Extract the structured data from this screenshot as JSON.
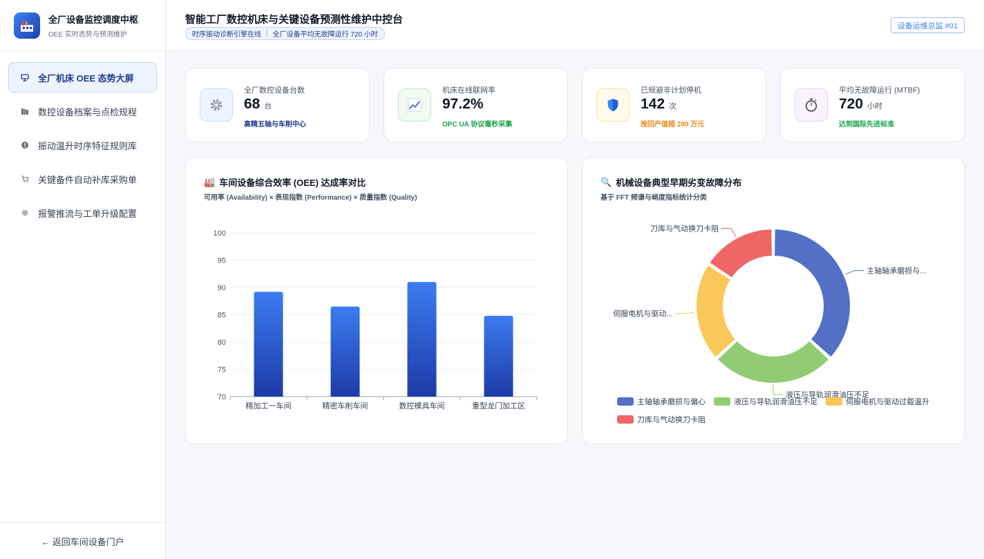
{
  "app": {
    "title": "全厂设备监控调度中枢",
    "subtitle": "OEE 实时态势与预测维护"
  },
  "sidebar": {
    "items": [
      {
        "label": "全厂机床 OEE 态势大屏",
        "icon": "monitor-icon",
        "active": true
      },
      {
        "label": "数控设备档案与点检规程",
        "icon": "archive-icon",
        "active": false
      },
      {
        "label": "振动温升时序特征规则库",
        "icon": "alert-icon",
        "active": false
      },
      {
        "label": "关键备件自动补库采购单",
        "icon": "cart-icon",
        "active": false
      },
      {
        "label": "报警推流与工单升级配置",
        "icon": "gear-icon",
        "active": false
      }
    ],
    "footer": "← 返回车间设备门户"
  },
  "header": {
    "title": "智能工厂数控机床与关键设备预测性维护中控台",
    "pill_left": "时序振动诊断引擎在线",
    "pill_sep": "|",
    "pill_right": "全厂设备平均无故障运行 720 小时",
    "badge": "设备运维总监 #01"
  },
  "kpis": [
    {
      "label": "全厂数控设备台数",
      "value": "68",
      "unit": "台",
      "note": "高精五轴与车削中心",
      "note_color": "#1e3a8a",
      "icon": "gear-icon",
      "icon_glyph": "⚙️",
      "icon_bg": "#eef4ff",
      "icon_border": "#c9dafb"
    },
    {
      "label": "机床在线联网率",
      "value": "97.2%",
      "unit": "",
      "note": "OPC UA 协议毫秒采集",
      "note_color": "#16a34a",
      "icon": "chart-up-icon",
      "icon_glyph": "📈",
      "icon_bg": "#effbf3",
      "icon_border": "#bfe9cd"
    },
    {
      "label": "已规避非计划停机",
      "value": "142",
      "unit": "次",
      "note": "挽回产值超 280 万元",
      "note_color": "#ea8a1a",
      "icon": "shield-icon",
      "icon_glyph": "🛡️",
      "icon_bg": "#fffbea",
      "icon_border": "#f6e3a4"
    },
    {
      "label": "平均无故障运行 (MTBF)",
      "value": "720",
      "unit": "小时",
      "note": "达到国际先进标准",
      "note_color": "#16a34a",
      "icon": "stopwatch-icon",
      "icon_glyph": "⏱️",
      "icon_bg": "#faf3ff",
      "icon_border": "#e6d3f5"
    }
  ],
  "bar_panel": {
    "title": "车间设备综合效率 (OEE) 达成率对比",
    "title_icon": "🏭",
    "subtitle": "可用率 (Availability) × 表现指数 (Performance) × 质量指数 (Quality)"
  },
  "pie_panel": {
    "title": "机械设备典型早期劣变故障分布",
    "title_icon": "🔍",
    "subtitle": "基于 FFT 频谱与峭度指标统计分类"
  },
  "chart_data": [
    {
      "type": "bar",
      "categories": [
        "精加工一车间",
        "精密车削车间",
        "数控模具车间",
        "重型龙门加工区"
      ],
      "values": [
        89.2,
        86.5,
        91.0,
        84.8
      ],
      "ylim": [
        70,
        100
      ],
      "yticks": [
        70,
        75,
        80,
        85,
        90,
        95,
        100
      ],
      "grid": true,
      "color_top": "#3b7cf0",
      "color_bottom": "#1e3aa8"
    },
    {
      "type": "pie",
      "donut": true,
      "labels": [
        "主轴轴承磨损与偏心",
        "液压与导轨润滑油压不足",
        "伺服电机与驱动过载温升",
        "刀库与气动换刀卡阻"
      ],
      "callouts": [
        "主轴轴承磨损与...",
        "液压与导轨润滑油压不足",
        "伺服电机与驱动...",
        "刀库与气动换刀卡阻"
      ],
      "values": [
        35,
        25,
        20,
        15
      ],
      "colors": [
        "#5470c6",
        "#91cc75",
        "#fac858",
        "#ee6666"
      ],
      "legend": "bottom"
    }
  ]
}
